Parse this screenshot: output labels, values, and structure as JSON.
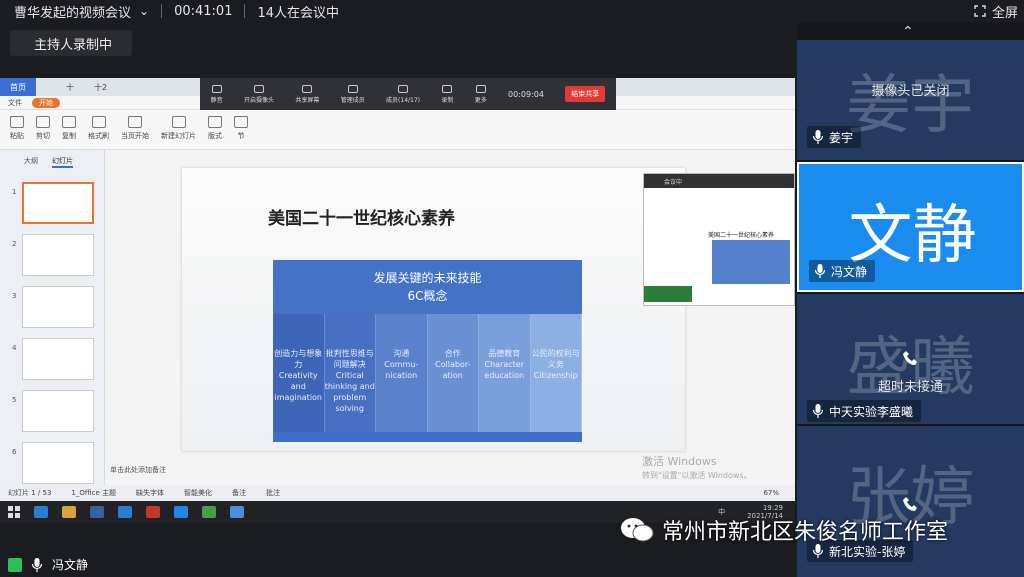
{
  "meeting": {
    "title": "曹华发起的视频会议",
    "duration": "00:41:01",
    "participants_count": "14人在会议中",
    "fullscreen_label": "全屏",
    "recording_badge": "主持人录制中"
  },
  "screen": {
    "tabs": [
      "首页",
      "",
      "十",
      "十2"
    ],
    "menu": [
      "文件",
      "开始"
    ],
    "ribbon": [
      "粘贴",
      "剪切",
      "复制",
      "格式刷",
      "当页开始",
      "新建幻灯片",
      "版式",
      "节"
    ],
    "meet_toolbar": {
      "items": [
        "静音",
        "开启摄像头",
        "共享屏幕",
        "管理成员",
        "成员(14/17)",
        "录制",
        "更多"
      ],
      "timer": "00:09:04",
      "end_label": "结束共享"
    },
    "left_panel_tabs": [
      "大纲",
      "幻灯片"
    ],
    "thumb_numbers": [
      "1",
      "2",
      "3",
      "4",
      "5",
      "6"
    ],
    "slide": {
      "title": "美国二十一世纪核心素养",
      "header_line1": "发展关键的未来技能",
      "header_line2": "6C概念",
      "columns": [
        {
          "zh": "创造力与想象力",
          "en": "Creativity and imagination"
        },
        {
          "zh": "批判性思维与问题解决",
          "en": "Critical thinking and problem solving"
        },
        {
          "zh": "沟通",
          "en": "Commu-nication"
        },
        {
          "zh": "合作",
          "en": "Collabor-ation"
        },
        {
          "zh": "品德教育",
          "en": "Character education"
        },
        {
          "zh": "公民的权利与义务",
          "en": "Citizenship"
        }
      ]
    },
    "notes_placeholder": "单击此处添加备注",
    "activation_line1": "激活 Windows",
    "activation_line2": "转到\"设置\"以激活 Windows。",
    "status": {
      "slide_counter": "幻灯片 1 / 53",
      "theme": "1_Office 主题",
      "missing_font": "缺失字体",
      "beautify": "智能美化",
      "notes": "备注",
      "comments": "批注",
      "zoom": "67%"
    },
    "taskbar": {
      "time": "19:29",
      "date": "2021/7/14",
      "lang": "中"
    },
    "mini_window": {
      "bar": "会议中",
      "slide_title": "美国二十一世纪核心素养"
    }
  },
  "participants": [
    {
      "big": "姜宇",
      "overlay": "摄像头已关闭",
      "name": "姜宇",
      "active": false
    },
    {
      "big": "文静",
      "overlay": "",
      "name": "冯文静",
      "active": true
    },
    {
      "big": "盛曦",
      "overlay": "超时未接通",
      "name": "中天实验李盛曦",
      "active": false
    },
    {
      "big": "张婷",
      "overlay": "",
      "name": "新北实验-张婷",
      "active": false
    }
  ],
  "self_label": "冯文静",
  "brand": "常州市新北区朱俊名师工作室",
  "colors": {
    "active_tile": "#1a8cf0",
    "tile": "#243a60",
    "end_button": "#e23a34",
    "slide_blue": "#4472c4"
  }
}
